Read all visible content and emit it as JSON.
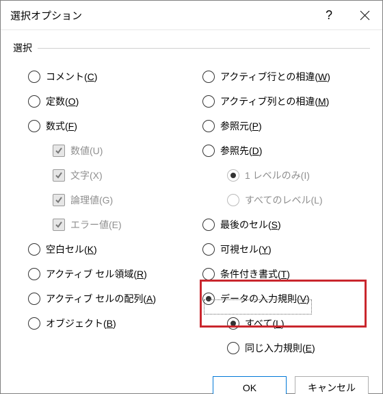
{
  "title": "選択オプション",
  "help_tooltip": "ヘルプ",
  "close_tooltip": "閉じる",
  "group_label": "選択",
  "left": {
    "comment": {
      "text": "コメント(",
      "accel": "C",
      "tail": ")"
    },
    "constant": {
      "text": "定数(",
      "accel": "O",
      "tail": ")"
    },
    "formula": {
      "text": "数式(",
      "accel": "F",
      "tail": ")"
    },
    "formula_number": {
      "text": "数値(U)"
    },
    "formula_text": {
      "text": "文字(X)"
    },
    "formula_logical": {
      "text": "論理値(G)"
    },
    "formula_error": {
      "text": "エラー値(E)"
    },
    "blanks": {
      "text": "空白セル(",
      "accel": "K",
      "tail": ")"
    },
    "region": {
      "text": "アクティブ セル領域(",
      "accel": "R",
      "tail": ")"
    },
    "array": {
      "text": "アクティブ セルの配列(",
      "accel": "A",
      "tail": ")"
    },
    "objects": {
      "text": "オブジェクト(",
      "accel": "B",
      "tail": ")"
    }
  },
  "right": {
    "row_diff": {
      "text": "アクティブ行との相違(",
      "accel": "W",
      "tail": ")"
    },
    "col_diff": {
      "text": "アクティブ列との相違(",
      "accel": "M",
      "tail": ")"
    },
    "precedents": {
      "text": "参照元(",
      "accel": "P",
      "tail": ")"
    },
    "dependents": {
      "text": "参照先(",
      "accel": "D",
      "tail": ")"
    },
    "one_level": {
      "text": "1 レベルのみ(I)"
    },
    "all_levels": {
      "text": "すべてのレベル(L)"
    },
    "last_cell": {
      "text": "最後のセル(",
      "accel": "S",
      "tail": ")"
    },
    "visible": {
      "text": "可視セル(",
      "accel": "Y",
      "tail": ")"
    },
    "cond_fmt": {
      "text": "条件付き書式(",
      "accel": "T",
      "tail": ")"
    },
    "data_validation": {
      "text": "データの入力規則(",
      "accel": "V",
      "tail": ")"
    },
    "dv_all": {
      "text": "すべて(",
      "accel": "L",
      "tail": ")"
    },
    "dv_same": {
      "text": "同じ入力規則(",
      "accel": "E",
      "tail": ")"
    }
  },
  "buttons": {
    "ok": "OK",
    "cancel": "キャンセル"
  },
  "state": {
    "main_selected": "data_validation",
    "dv_sub_selected": "dv_all",
    "formula_children_checked": [
      true,
      true,
      true,
      true
    ]
  },
  "colors": {
    "highlight": "#c9262d",
    "default_button_border": "#0078d7"
  }
}
